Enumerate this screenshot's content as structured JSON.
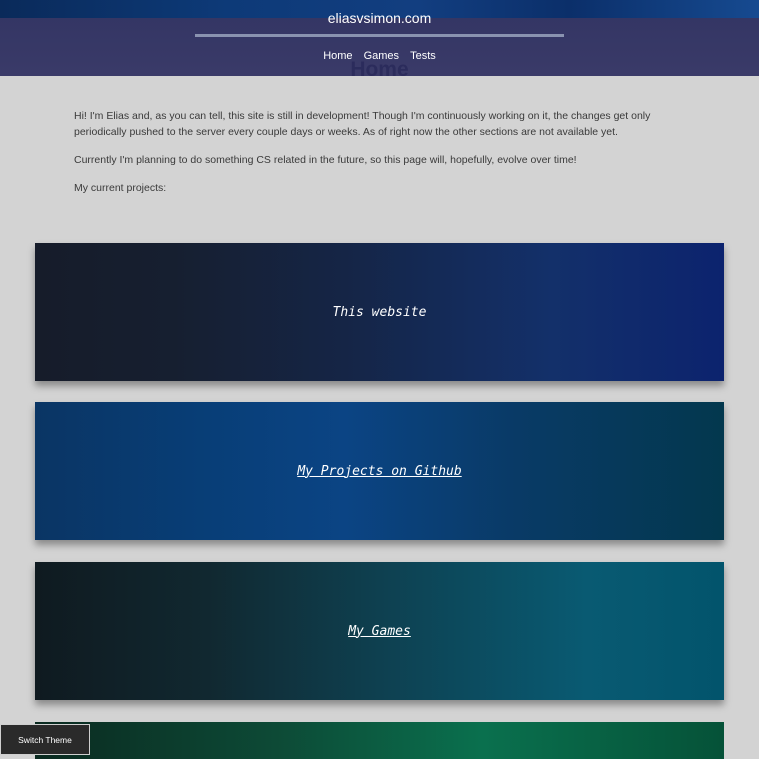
{
  "header": {
    "site_title": "eliasvsimon.com",
    "nav": [
      "Home",
      "Games",
      "Tests"
    ]
  },
  "main": {
    "page_title": "Home",
    "intro": [
      "Hi! I'm Elias and, as you can tell, this site is still in development! Though I'm continuously working on it, the changes get only periodically pushed to the server every couple days or weeks. As of right now the other sections are not available yet.",
      "Currently I'm planning to do something CS related in the future, so this page will, hopefully, evolve over time!",
      "My current projects:"
    ],
    "projects": [
      {
        "label": "This website",
        "is_link": false
      },
      {
        "label": "My Projects on Github",
        "is_link": true
      },
      {
        "label": "My Games",
        "is_link": true
      },
      {
        "label": "",
        "is_link": false
      }
    ]
  },
  "theme_toggle": {
    "label": "Switch Theme"
  },
  "colors": {
    "page_background": "#d3d3d3",
    "header_background": "#2d2d5f",
    "text": "#3a3a3a",
    "title": "#1e1e3a"
  }
}
